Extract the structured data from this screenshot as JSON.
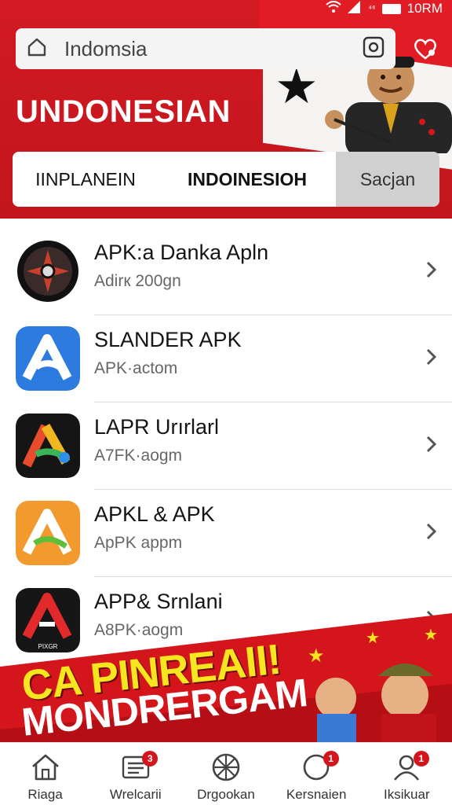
{
  "status_bar": {
    "time": "10RM",
    "signal_text": "⁴⁶"
  },
  "search": {
    "value": "Indomsia"
  },
  "header": {
    "title": "UNDONESIAN"
  },
  "tabs": [
    {
      "label": "IINPLANEIN"
    },
    {
      "label": "INDOINESIOH"
    },
    {
      "label": "Sacjan"
    }
  ],
  "apps": [
    {
      "name": "APK:a Danka Apln",
      "sub": "Adirк 200gn",
      "icon": "compass-badge-icon"
    },
    {
      "name": "SLANDER APK",
      "sub": "APK·actom",
      "icon": "blue-a-icon"
    },
    {
      "name": "LAPR Urırlarl",
      "sub": "A7FK·aogm",
      "icon": "rainbow-a-icon"
    },
    {
      "name": "APKL & APK",
      "sub": "ApPK appm",
      "icon": "orange-a-icon"
    },
    {
      "name": "APP& Srnlani",
      "sub": "A8PK·aogm",
      "icon": "red-a-icon",
      "icon_text": "PIXGR"
    }
  ],
  "banner": {
    "line1": "CA PINREAII!",
    "line2": "MONDRERGAM"
  },
  "nav": [
    {
      "label": "Riaga",
      "icon": "home-icon",
      "badge": ""
    },
    {
      "label": "Wrelcarii",
      "icon": "list-icon",
      "badge": "3"
    },
    {
      "label": "Drgookan",
      "icon": "wheel-icon",
      "badge": ""
    },
    {
      "label": "Kersnaien",
      "icon": "chat-icon",
      "badge": "1"
    },
    {
      "label": "Iksikuar",
      "icon": "profile-icon",
      "badge": "1"
    }
  ],
  "colors": {
    "brand_red": "#d21a22",
    "badge_red": "#d4161c",
    "banner_yellow": "#f6e51f"
  }
}
